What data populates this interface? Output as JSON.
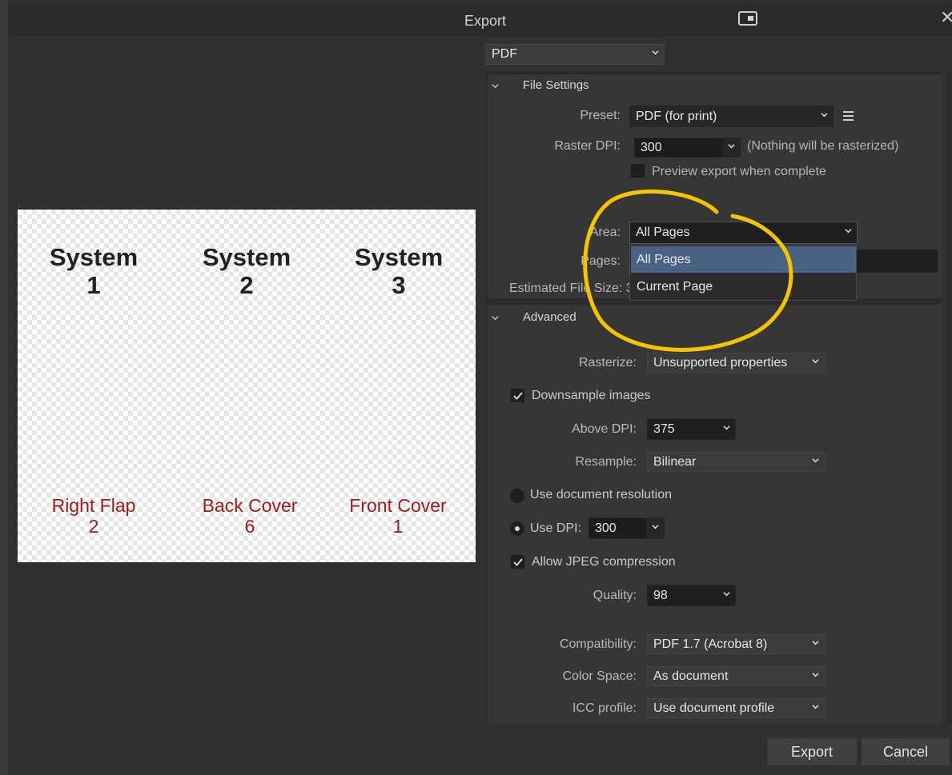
{
  "window": {
    "title": "Export"
  },
  "format": {
    "selected": "PDF"
  },
  "file_settings": {
    "header": "File Settings",
    "preset_label": "Preset:",
    "preset_value": "PDF (for print)",
    "raster_dpi_label": "Raster DPI:",
    "raster_dpi_value": "300",
    "raster_note": "(Nothing will be rasterized)",
    "preview_label": "Preview export when complete",
    "area_label": "Area:",
    "area_value": "All Pages",
    "pages_label": "Pages:",
    "estimated_label": "Estimated File Size: 3"
  },
  "area_menu": {
    "options": [
      "All Pages",
      "Current Page"
    ],
    "selected": "All Pages"
  },
  "advanced": {
    "header": "Advanced",
    "rasterize_label": "Rasterize:",
    "rasterize_value": "Unsupported properties",
    "downsample_label": "Downsample images",
    "downsample_checked": true,
    "above_dpi_label": "Above DPI:",
    "above_dpi_value": "375",
    "resample_label": "Resample:",
    "resample_value": "Bilinear",
    "use_doc_res_label": "Use document resolution",
    "use_dpi_label": "Use DPI:",
    "use_dpi_value": "300",
    "jpeg_label": "Allow JPEG compression",
    "jpeg_checked": true,
    "quality_label": "Quality:",
    "quality_value": "98",
    "compat_label": "Compatibility:",
    "compat_value": "PDF 1.7 (Acrobat 8)",
    "colorspace_label": "Color Space:",
    "colorspace_value": "As document",
    "icc_label": "ICC profile:",
    "icc_value": "Use document profile"
  },
  "preview": {
    "systems": [
      "System\n1",
      "System\n2",
      "System\n3"
    ],
    "covers": [
      "Right Flap\n2",
      "Back Cover\n6",
      "Front Cover\n1"
    ]
  },
  "buttons": {
    "export": "Export",
    "cancel": "Cancel"
  },
  "colors": {
    "menu_selected": "#4a6283",
    "annotation": "#f5c400",
    "cover_text": "#9c1c1c"
  },
  "icons": [
    "window-icon",
    "close-icon",
    "chevron-down-icon",
    "menu-icon",
    "check-icon"
  ]
}
